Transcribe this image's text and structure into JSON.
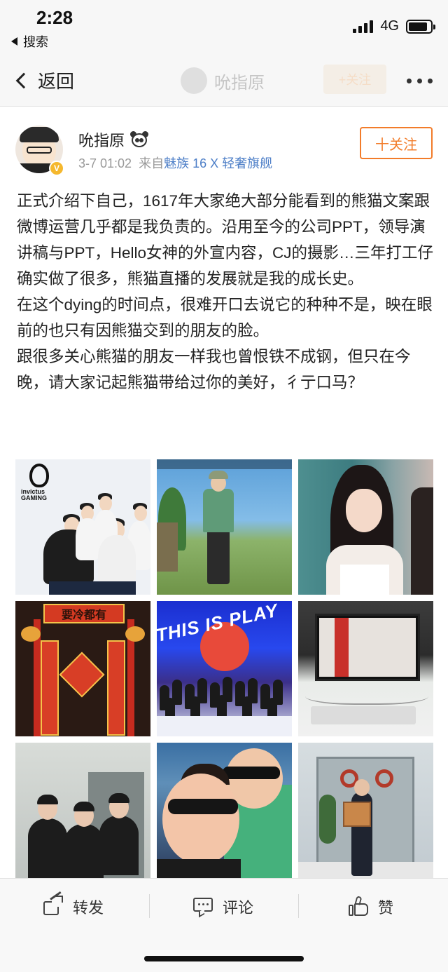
{
  "status_bar": {
    "time": "2:28",
    "back_app": "搜索",
    "network": "4G",
    "battery_level": 0.85
  },
  "nav": {
    "back_label": "返回",
    "title_name": "吮指原",
    "follow_label": "+关注"
  },
  "post": {
    "author": "吮指原",
    "verified_badge": "V",
    "date": "3-7 01:02",
    "source_prefix": "来自",
    "source_device": "魅族 16 X 轻奢旗舰",
    "follow_label": "十关注",
    "paragraphs": [
      "正式介绍下自己，1617年大家绝大部分能看到的熊猫文案跟微博运营几乎都是我负责的。沿用至今的公司PPT，领导演讲稿与PPT，Hello女神的外宣内容，CJ的摄影…三年打工仔确实做了很多，熊猫直播的发展就是我的成长史。",
      "在这个dying的时间点，很难开口去说它的种种不是，映在眼前的也只有因熊猫交到的朋友的脸。",
      "跟很多关心熊猫的朋友一样我也曾恨铁不成钢，但只在今晚，请大家记起熊猫带给过你的美好，彳亍口马？"
    ],
    "images": [
      {
        "desc": "team-photo",
        "logo_text": "invictus GAMING"
      },
      {
        "desc": "game-character"
      },
      {
        "desc": "girl-portrait"
      },
      {
        "desc": "spring-festival-door",
        "banner_text": "要冷都有"
      },
      {
        "desc": "stage-group",
        "banner_text": "THIS IS PLAY"
      },
      {
        "desc": "office-desk"
      },
      {
        "desc": "three-friends"
      },
      {
        "desc": "selfie"
      },
      {
        "desc": "office-delivery"
      }
    ]
  },
  "actions": {
    "repost": "转发",
    "comment": "评论",
    "like": "赞"
  }
}
